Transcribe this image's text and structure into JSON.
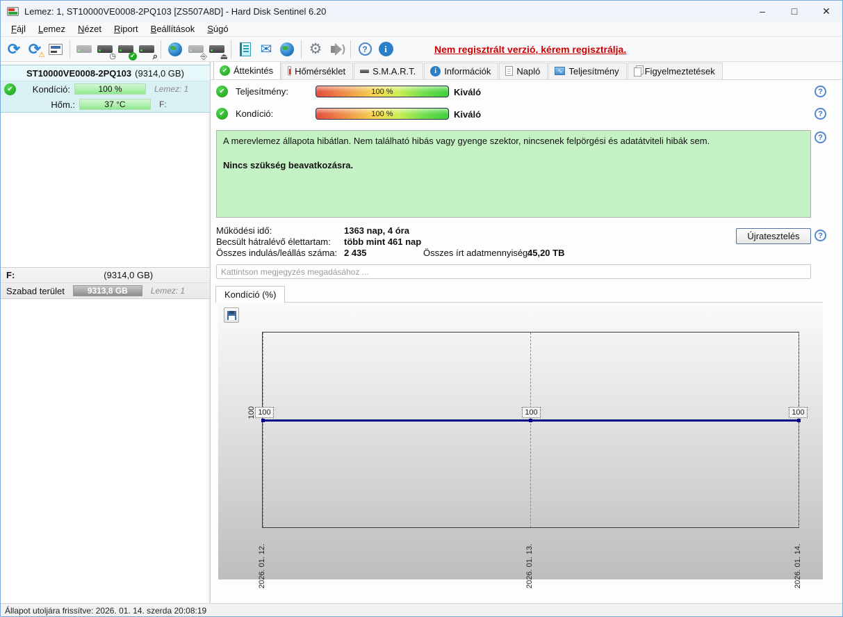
{
  "window": {
    "title": "Lemez: 1, ST10000VE0008-2PQ103 [ZS507A8D]  -  Hard Disk Sentinel 6.20",
    "controls": {
      "minimize": "–",
      "maximize": "□",
      "close": "✕"
    }
  },
  "menu": {
    "items": [
      "Fájl",
      "Lemez",
      "Nézet",
      "Riport",
      "Beállítások",
      "Súgó"
    ]
  },
  "toolbar": {
    "icons": [
      "refresh",
      "refresh-warning",
      "report",
      "disk-offline",
      "disk-clock",
      "disk-ok",
      "disk-search",
      "network-disk",
      "disk-usb",
      "disk-remove",
      "log",
      "email",
      "network-sound",
      "settings",
      "sound",
      "help",
      "info"
    ],
    "register_link": "Nem regisztrált verzió, kérem regisztrálja."
  },
  "sidebar": {
    "disk": {
      "model": "ST10000VE0008-2PQ103",
      "capacity": "(9314,0 GB)",
      "condition_label": "Kondíció:",
      "condition_value": "100 %",
      "disk_label": "Lemez: 1",
      "temp_label": "Hőm.:",
      "temp_value": "37 °C",
      "partition_letter": "F:"
    },
    "partition": {
      "letter": "F:",
      "capacity": "(9314,0 GB)",
      "free_label": "Szabad terület",
      "free_value": "9313,8 GB",
      "disk_label": "Lemez: 1"
    }
  },
  "tabs": [
    "Áttekintés",
    "Hőmérséklet",
    "S.M.A.R.T.",
    "Információk",
    "Napló",
    "Teljesítmény",
    "Figyelmeztetések"
  ],
  "overview": {
    "performance_label": "Teljesítmény:",
    "performance_value": "100 %",
    "performance_rating": "Kiváló",
    "condition_label": "Kondíció:",
    "condition_value": "100 %",
    "condition_rating": "Kiváló",
    "status_text": "A merevlemez állapota hibátlan. Nem található hibás vagy gyenge szektor, nincsenek felpörgési és adatátviteli hibák sem.",
    "status_advice": "Nincs szükség beavatkozásra.",
    "stats": {
      "row1": {
        "label": "Működési idő:",
        "value": "1363 nap, 4 óra"
      },
      "row2": {
        "label": "Becsült hátralévő élettartam:",
        "value": "több mint 461 nap"
      },
      "row3": {
        "label": "Összes indulás/leállás száma:",
        "value": "2 435"
      },
      "row3b": {
        "label": "Összes írt adatmennyiség:",
        "value": "45,20 TB"
      }
    },
    "retest_button": "Újratesztelés",
    "comment_placeholder": "Kattintson megjegyzés megadásához ..."
  },
  "chart_data": {
    "type": "line",
    "title": "Kondíció  (%)",
    "x_labels": [
      "2026. 01. 12.",
      "2026. 01. 13.",
      "2026. 01. 14."
    ],
    "values": [
      100,
      100,
      100
    ],
    "point_labels": [
      "100",
      "100",
      "100"
    ],
    "y_axis_label": "100",
    "line_color": "#00008b",
    "grid": "dashed-vertical-at-each-date",
    "legend_position": "none"
  },
  "statusbar": {
    "text": "Állapot utoljára frissítve: 2026. 01. 14. szerda 20:08:19"
  }
}
